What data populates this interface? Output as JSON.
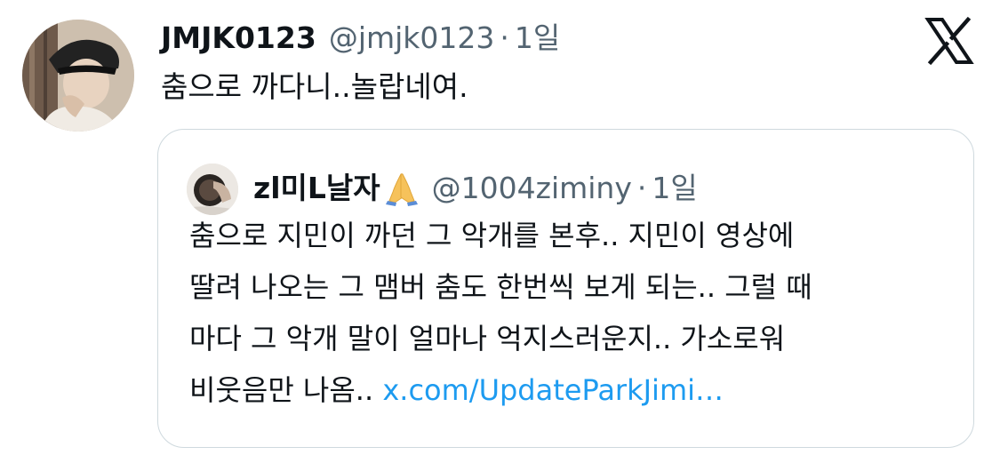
{
  "tweet": {
    "display_name": "JMJK0123",
    "handle": "@jmjk0123",
    "separator": "·",
    "time": "1일",
    "text": "춤으로 까다니..놀랍네여."
  },
  "quoted_tweet": {
    "display_name": "zl미L날자",
    "emoji": "praying-hands-emoji",
    "handle": "@1004ziminy",
    "separator": "·",
    "time": "1일",
    "lines": [
      "춤으로 지민이 까던 그 악개를 본후.. 지민이 영상에",
      "딸려 나오는 그 맴버 춤도 한번씩 보게 되는.. 그럴 때",
      "마다 그 악개 말이 얼마나 억지스러운지.. 가소로워"
    ],
    "last_line_text": "비웃음만 나옴..",
    "link_text": "x.com/UpdateParkJimi…"
  },
  "icons": {
    "logo": "x-logo-icon"
  },
  "colors": {
    "text_primary": "#0f1419",
    "text_secondary": "#536471",
    "link": "#1d9bf0",
    "card_border": "#cfd9de"
  }
}
